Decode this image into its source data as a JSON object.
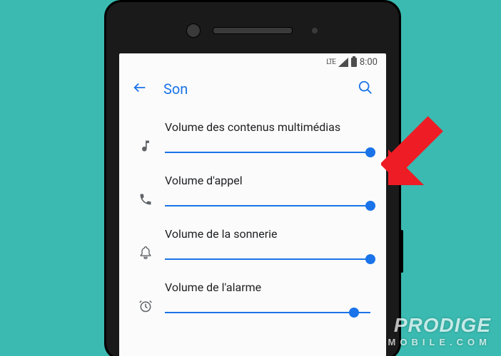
{
  "status_bar": {
    "time": "8:00",
    "signal": "LTE"
  },
  "appbar": {
    "title": "Son"
  },
  "sliders": [
    {
      "label": "Volume des contenus multimédias",
      "icon": "music-note",
      "value": 100
    },
    {
      "label": "Volume d'appel",
      "icon": "phone",
      "value": 100
    },
    {
      "label": "Volume de la sonnerie",
      "icon": "bell",
      "value": 100
    },
    {
      "label": "Volume de l'alarme",
      "icon": "alarm",
      "value": 92
    }
  ],
  "accent": "#1a73e8",
  "watermark": {
    "line1": "PRODIGE",
    "line2": "MOBILE.COM"
  }
}
